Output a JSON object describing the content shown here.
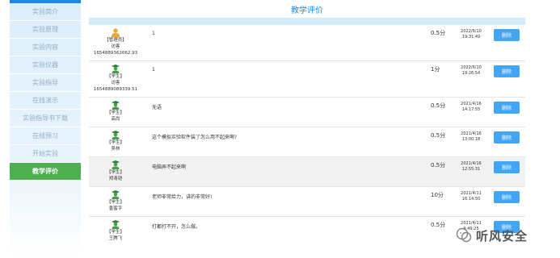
{
  "sidebar": {
    "items": [
      {
        "label": "实验简介",
        "active": false
      },
      {
        "label": "实验原理",
        "active": false
      },
      {
        "label": "实验内容",
        "active": false
      },
      {
        "label": "实验仪器",
        "active": false
      },
      {
        "label": "实验指导",
        "active": false
      },
      {
        "label": "在线演示",
        "active": false
      },
      {
        "label": "实验指导书下载",
        "active": false
      },
      {
        "label": "在线预习",
        "active": false
      },
      {
        "label": "开始实验",
        "active": false
      },
      {
        "label": "教学评价",
        "active": true
      }
    ],
    "accent_color": "#4caf50"
  },
  "page": {
    "title": "教学评价",
    "title_color": "#1e88e5"
  },
  "comments": [
    {
      "role": "【管理员】",
      "name": "访客",
      "id": "1654889362662.93",
      "text": "1",
      "score": "0.5分",
      "date": "2022/6/10",
      "time": "19:31:49",
      "delete_label": "删除",
      "avatar": "admin-avatar-icon"
    },
    {
      "role": "【学生】",
      "name": "访客",
      "id": "1654889089339.51",
      "text": "1",
      "score": "1分",
      "date": "2022/6/10",
      "time": "19:26:54",
      "delete_label": "删除",
      "avatar": "student-avatar-icon"
    },
    {
      "role": "【学生】",
      "name": "高尚",
      "text": "无语",
      "score": "0.5分",
      "date": "2021/4/16",
      "time": "14:17:55",
      "delete_label": "删除",
      "avatar": "student-avatar-icon"
    },
    {
      "role": "【学生】",
      "name": "吴林",
      "text": "这个模拟实验软件装了怎么用不起来啊?",
      "score": "0.5分",
      "date": "2021/4/16",
      "time": "13:00:18",
      "delete_label": "删除",
      "avatar": "student-avatar-icon"
    },
    {
      "role": "【学生】",
      "name": "郑清铠",
      "text": "电脑弄不起来啊",
      "score": "0.5分",
      "date": "2021/4/16",
      "time": "12:55:31",
      "delete_label": "删除",
      "avatar": "student-avatar-icon"
    },
    {
      "role": "【学生】",
      "name": "香蜜字",
      "text": "老师非常给力，讲的非常好!",
      "score": "10分",
      "date": "2021/4/11",
      "time": "16:14:50",
      "delete_label": "删除",
      "avatar": "student-avatar-icon"
    },
    {
      "role": "【学生】",
      "name": "王腾飞",
      "text": "打都打不开，怎么做。",
      "score": "0.5分",
      "date": "2021/4/11",
      "time": "9:49:25",
      "delete_label": "删除",
      "avatar": "student-avatar-icon"
    }
  ],
  "watermark": {
    "text": "听风安全"
  },
  "colors": {
    "header_bar": "#d4ebfb",
    "delete_button": "#42a5f5",
    "admin_avatar": "#f5a623",
    "student_avatar": "#43a047"
  }
}
